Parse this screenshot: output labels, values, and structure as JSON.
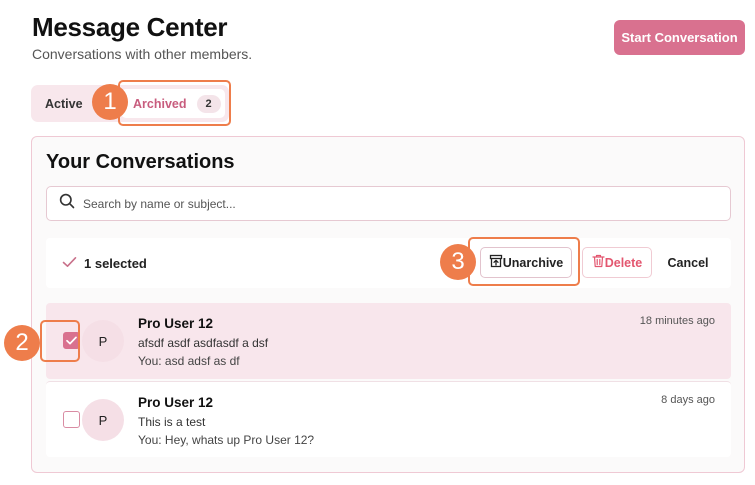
{
  "header": {
    "title": "Message Center",
    "subtitle": "Conversations with other members.",
    "start_button": "Start Conversation"
  },
  "tabs": [
    {
      "label": "Active"
    },
    {
      "label": "Archived",
      "count": "2",
      "selected": true
    }
  ],
  "panel": {
    "title": "Your Conversations",
    "search_placeholder": "Search by name or subject..."
  },
  "selection_bar": {
    "selected_text": "1 selected",
    "unarchive_label": "Unarchive",
    "delete_label": "Delete",
    "cancel_label": "Cancel"
  },
  "conversations": [
    {
      "avatar": "P",
      "name": "Pro User 12",
      "subject": "afsdf asdf asdfasdf a dsf",
      "preview": "You: asd adsf as df",
      "time": "18 minutes ago",
      "checked": true
    },
    {
      "avatar": "P",
      "name": "Pro User 12",
      "subject": "This is a test",
      "preview": "You: Hey, whats up Pro User 12?",
      "time": "8 days ago",
      "checked": false
    }
  ],
  "annotations": [
    "1",
    "2",
    "3"
  ],
  "colors": {
    "accent": "#d9718f",
    "callout": "#ee7d4b",
    "danger": "#e3566f"
  }
}
